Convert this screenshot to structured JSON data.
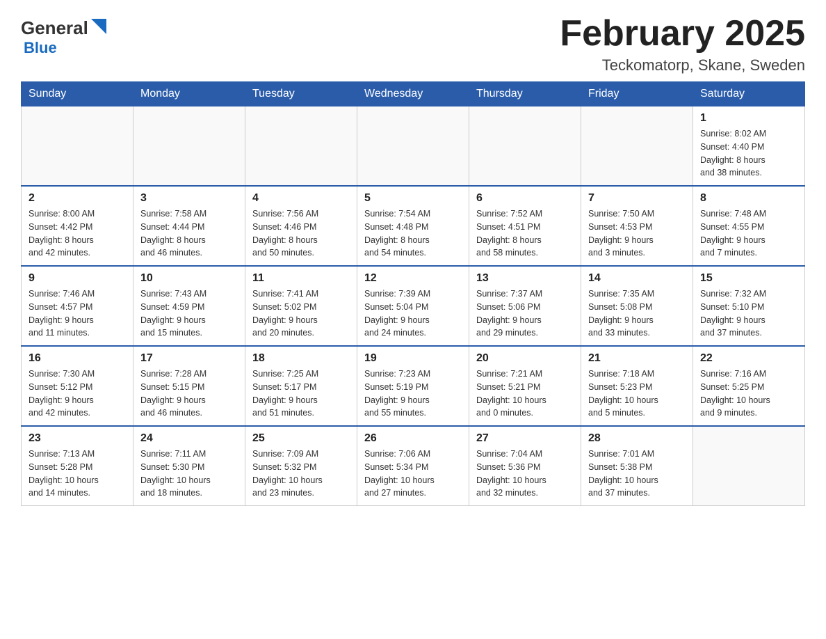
{
  "header": {
    "logo_main": "General",
    "logo_sub": "Blue",
    "month_title": "February 2025",
    "location": "Teckomatorp, Skane, Sweden"
  },
  "days_of_week": [
    "Sunday",
    "Monday",
    "Tuesday",
    "Wednesday",
    "Thursday",
    "Friday",
    "Saturday"
  ],
  "weeks": [
    [
      {
        "day": "",
        "info": ""
      },
      {
        "day": "",
        "info": ""
      },
      {
        "day": "",
        "info": ""
      },
      {
        "day": "",
        "info": ""
      },
      {
        "day": "",
        "info": ""
      },
      {
        "day": "",
        "info": ""
      },
      {
        "day": "1",
        "info": "Sunrise: 8:02 AM\nSunset: 4:40 PM\nDaylight: 8 hours\nand 38 minutes."
      }
    ],
    [
      {
        "day": "2",
        "info": "Sunrise: 8:00 AM\nSunset: 4:42 PM\nDaylight: 8 hours\nand 42 minutes."
      },
      {
        "day": "3",
        "info": "Sunrise: 7:58 AM\nSunset: 4:44 PM\nDaylight: 8 hours\nand 46 minutes."
      },
      {
        "day": "4",
        "info": "Sunrise: 7:56 AM\nSunset: 4:46 PM\nDaylight: 8 hours\nand 50 minutes."
      },
      {
        "day": "5",
        "info": "Sunrise: 7:54 AM\nSunset: 4:48 PM\nDaylight: 8 hours\nand 54 minutes."
      },
      {
        "day": "6",
        "info": "Sunrise: 7:52 AM\nSunset: 4:51 PM\nDaylight: 8 hours\nand 58 minutes."
      },
      {
        "day": "7",
        "info": "Sunrise: 7:50 AM\nSunset: 4:53 PM\nDaylight: 9 hours\nand 3 minutes."
      },
      {
        "day": "8",
        "info": "Sunrise: 7:48 AM\nSunset: 4:55 PM\nDaylight: 9 hours\nand 7 minutes."
      }
    ],
    [
      {
        "day": "9",
        "info": "Sunrise: 7:46 AM\nSunset: 4:57 PM\nDaylight: 9 hours\nand 11 minutes."
      },
      {
        "day": "10",
        "info": "Sunrise: 7:43 AM\nSunset: 4:59 PM\nDaylight: 9 hours\nand 15 minutes."
      },
      {
        "day": "11",
        "info": "Sunrise: 7:41 AM\nSunset: 5:02 PM\nDaylight: 9 hours\nand 20 minutes."
      },
      {
        "day": "12",
        "info": "Sunrise: 7:39 AM\nSunset: 5:04 PM\nDaylight: 9 hours\nand 24 minutes."
      },
      {
        "day": "13",
        "info": "Sunrise: 7:37 AM\nSunset: 5:06 PM\nDaylight: 9 hours\nand 29 minutes."
      },
      {
        "day": "14",
        "info": "Sunrise: 7:35 AM\nSunset: 5:08 PM\nDaylight: 9 hours\nand 33 minutes."
      },
      {
        "day": "15",
        "info": "Sunrise: 7:32 AM\nSunset: 5:10 PM\nDaylight: 9 hours\nand 37 minutes."
      }
    ],
    [
      {
        "day": "16",
        "info": "Sunrise: 7:30 AM\nSunset: 5:12 PM\nDaylight: 9 hours\nand 42 minutes."
      },
      {
        "day": "17",
        "info": "Sunrise: 7:28 AM\nSunset: 5:15 PM\nDaylight: 9 hours\nand 46 minutes."
      },
      {
        "day": "18",
        "info": "Sunrise: 7:25 AM\nSunset: 5:17 PM\nDaylight: 9 hours\nand 51 minutes."
      },
      {
        "day": "19",
        "info": "Sunrise: 7:23 AM\nSunset: 5:19 PM\nDaylight: 9 hours\nand 55 minutes."
      },
      {
        "day": "20",
        "info": "Sunrise: 7:21 AM\nSunset: 5:21 PM\nDaylight: 10 hours\nand 0 minutes."
      },
      {
        "day": "21",
        "info": "Sunrise: 7:18 AM\nSunset: 5:23 PM\nDaylight: 10 hours\nand 5 minutes."
      },
      {
        "day": "22",
        "info": "Sunrise: 7:16 AM\nSunset: 5:25 PM\nDaylight: 10 hours\nand 9 minutes."
      }
    ],
    [
      {
        "day": "23",
        "info": "Sunrise: 7:13 AM\nSunset: 5:28 PM\nDaylight: 10 hours\nand 14 minutes."
      },
      {
        "day": "24",
        "info": "Sunrise: 7:11 AM\nSunset: 5:30 PM\nDaylight: 10 hours\nand 18 minutes."
      },
      {
        "day": "25",
        "info": "Sunrise: 7:09 AM\nSunset: 5:32 PM\nDaylight: 10 hours\nand 23 minutes."
      },
      {
        "day": "26",
        "info": "Sunrise: 7:06 AM\nSunset: 5:34 PM\nDaylight: 10 hours\nand 27 minutes."
      },
      {
        "day": "27",
        "info": "Sunrise: 7:04 AM\nSunset: 5:36 PM\nDaylight: 10 hours\nand 32 minutes."
      },
      {
        "day": "28",
        "info": "Sunrise: 7:01 AM\nSunset: 5:38 PM\nDaylight: 10 hours\nand 37 minutes."
      },
      {
        "day": "",
        "info": ""
      }
    ]
  ]
}
